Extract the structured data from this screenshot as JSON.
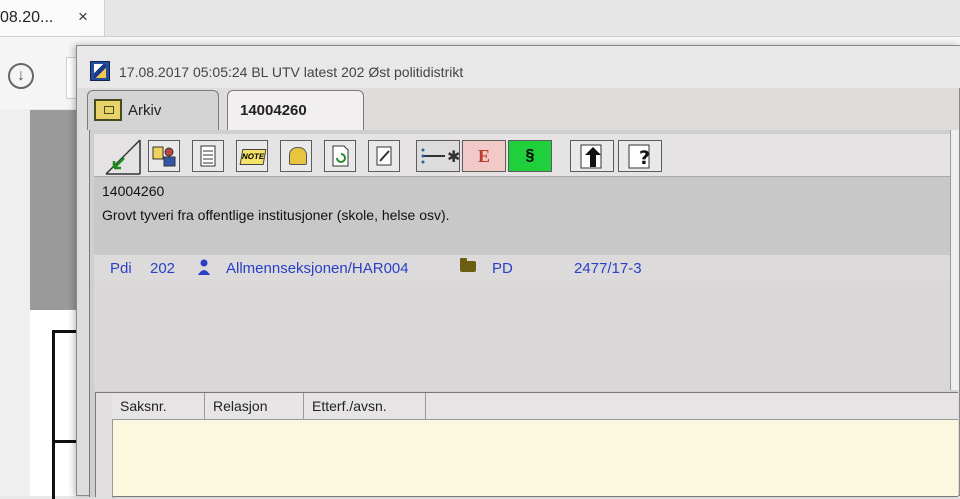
{
  "browser": {
    "tab_title": "08.20...",
    "tab_close": "×",
    "download_icon": "download-icon"
  },
  "window": {
    "title": "17.08.2017 05:05:24 BL UTV latest 202 Øst politidistrikt",
    "icon": "app-logo-icon"
  },
  "tabs": [
    {
      "label": "Arkiv",
      "icon": "archive-box-icon"
    },
    {
      "label": "14004260",
      "active": true
    }
  ],
  "toolbar": {
    "buttons": [
      {
        "icon": "diagonal-arrow-icon"
      },
      {
        "icon": "users-icon"
      },
      {
        "icon": "list-icon"
      },
      {
        "icon": "note-icon",
        "text": "NOTE"
      },
      {
        "icon": "bell-icon"
      },
      {
        "icon": "document-refresh-icon"
      },
      {
        "icon": "edit-document-icon"
      },
      {
        "icon": "link-star-icon"
      },
      {
        "icon": "e-icon",
        "text": "E"
      },
      {
        "icon": "paragraph-icon",
        "text": "§"
      },
      {
        "icon": "upload-arrow-icon"
      },
      {
        "icon": "help-document-icon"
      }
    ]
  },
  "case": {
    "number": "14004260",
    "description": "Grovt tyveri fra offentlige institusjoner (skole, helse osv)."
  },
  "meta": {
    "type": "Pdi",
    "district": "202",
    "unit": "Allmennseksjonen/HAR004",
    "category": "PD",
    "ref": "2477/17-3"
  },
  "table": {
    "columns": [
      "Saksnr.",
      "Relasjon",
      "Etterf./avsn."
    ]
  },
  "colors": {
    "accent_text": "#2a3fc6",
    "table_bg": "#fbf8df",
    "paragraph_btn": "#1fcf3b"
  }
}
